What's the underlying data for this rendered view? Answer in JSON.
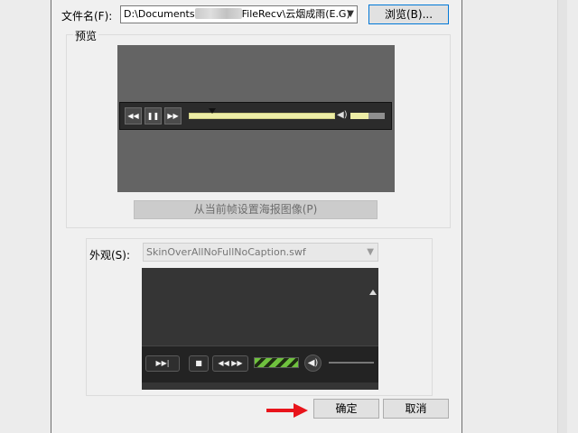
{
  "file": {
    "label": "文件名(F):",
    "path_prefix": "D:\\Documents",
    "path_suffix": "FileRecv\\云烟成雨(E.G)",
    "browse_label": "浏览(B)..."
  },
  "preview": {
    "group_title": "预览",
    "poster_button": "从当前帧设置海报图像(P)"
  },
  "skin": {
    "label": "外观(S):",
    "selected": "SkinOverAllNoFullNoCaption.swf"
  },
  "buttons": {
    "ok": "确定",
    "cancel": "取消"
  },
  "colors": {
    "dialog_bg": "#f0f0f0",
    "focus_border": "#0078d7",
    "seek_bar": "#ededa6",
    "progress_green": "#6fc23e",
    "arrow_red": "#e8141b"
  },
  "icons": [
    "rewind-icon",
    "pause-icon",
    "forward-icon",
    "volume-icon",
    "play-icon",
    "stop-icon",
    "chevron-down-icon",
    "red-arrow-icon"
  ]
}
